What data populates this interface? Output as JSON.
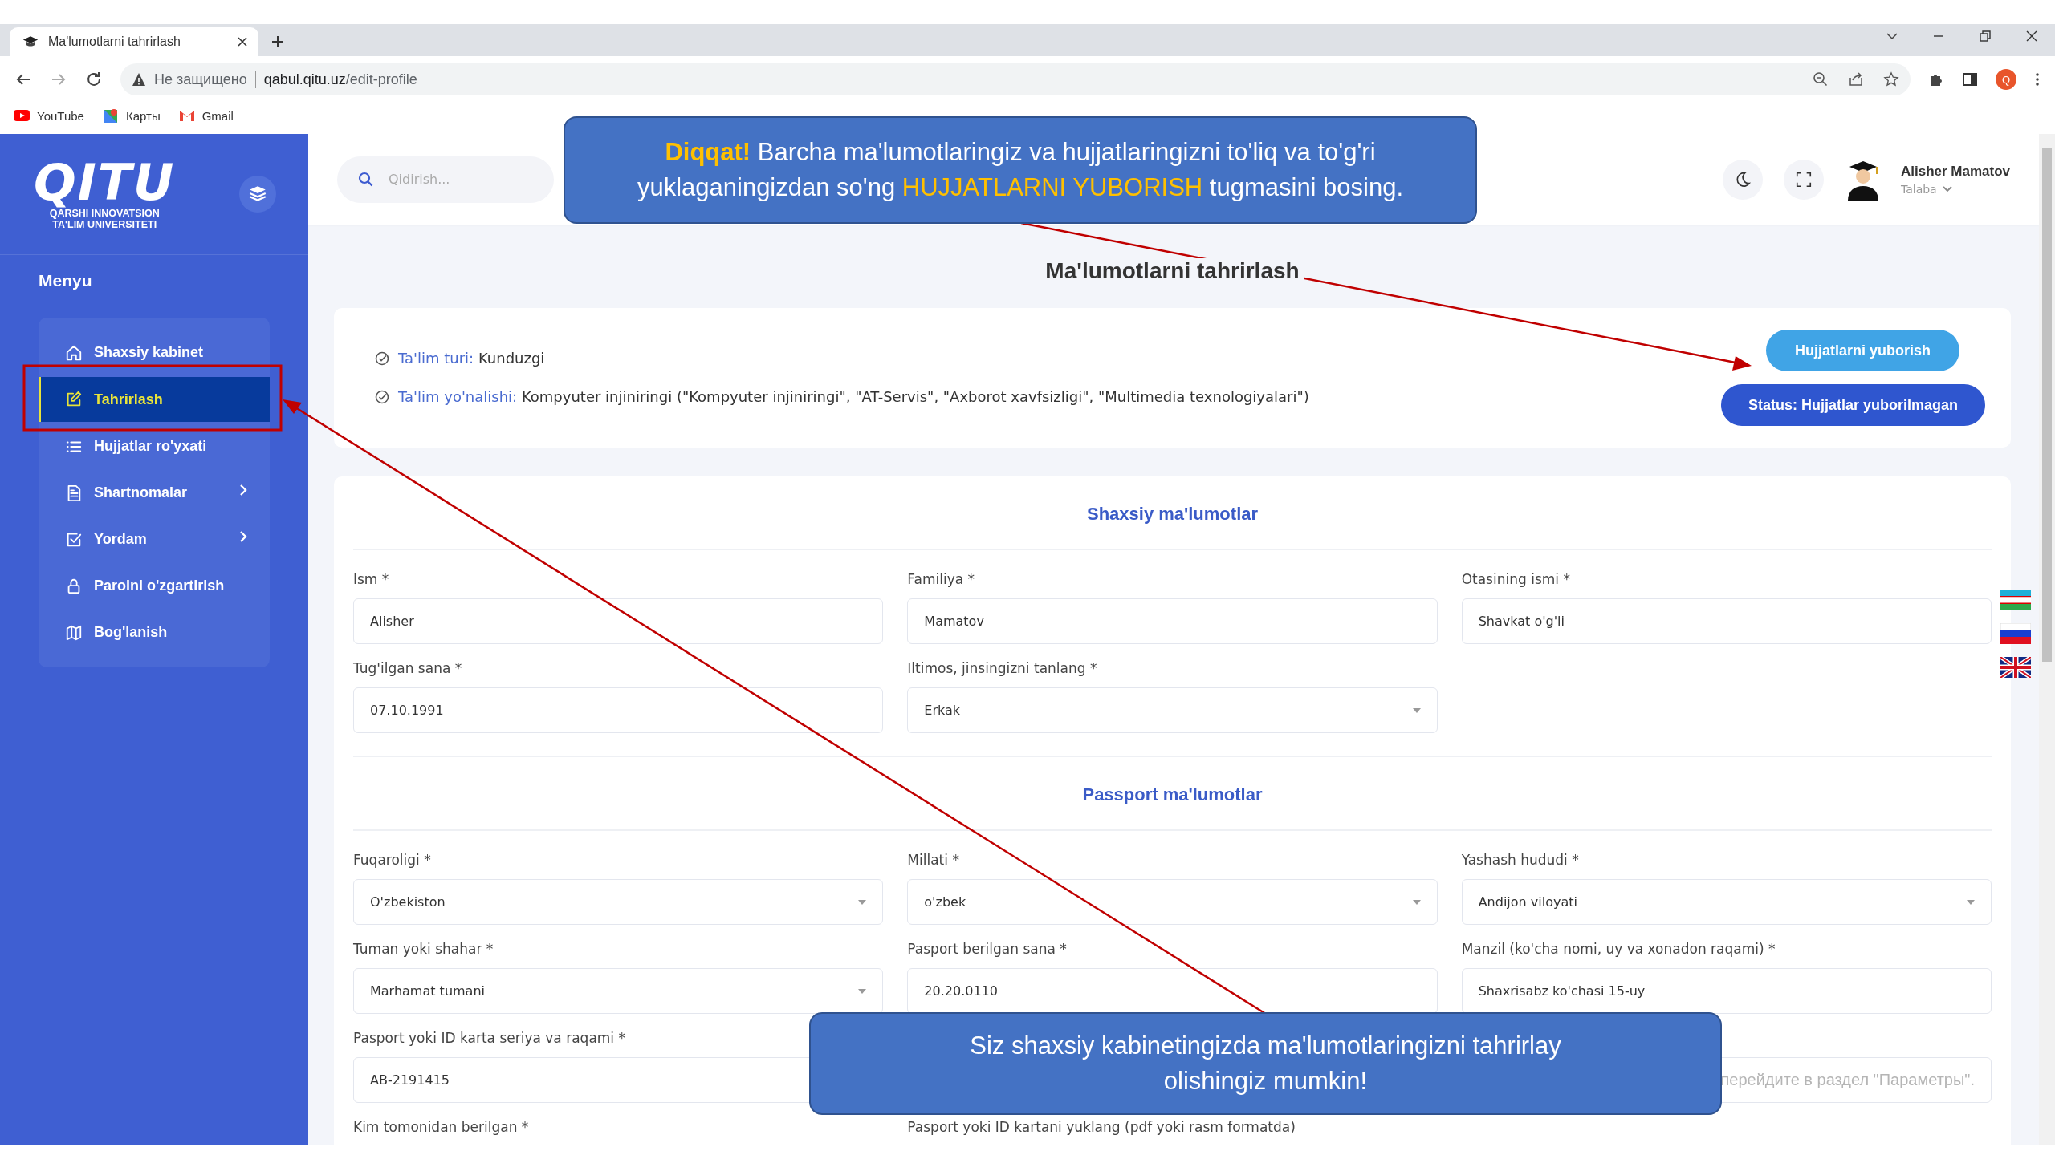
{
  "browser": {
    "tab_title": "Ma'lumotlarni tahrirlash",
    "security": "Не защищено",
    "url_host": "qabul.qitu.uz",
    "url_path": "/edit-profile",
    "profile_initial": "Q",
    "bookmarks": [
      {
        "label": "YouTube",
        "kind": "youtube"
      },
      {
        "label": "Карты",
        "kind": "maps"
      },
      {
        "label": "Gmail",
        "kind": "gmail"
      }
    ]
  },
  "sidebar": {
    "logo_word": "QITU",
    "logo_subtitle": [
      "QARSHI INNOVATSION",
      "TA'LIM UNIVERSITETI"
    ],
    "menu_title": "Menyu",
    "items": [
      {
        "label": "Shaxsiy kabinet",
        "kind": "link",
        "selected": false
      },
      {
        "label": "Tahrirlash",
        "kind": "link",
        "selected": true
      },
      {
        "label": "Hujjatlar ro'yxati",
        "kind": "link",
        "selected": false
      },
      {
        "label": "Shartnomalar",
        "kind": "submenu",
        "selected": false
      },
      {
        "label": "Yordam",
        "kind": "submenu",
        "selected": false
      },
      {
        "label": "Parolni o'zgartirish",
        "kind": "link",
        "selected": false
      },
      {
        "label": "Bog'lanish",
        "kind": "link",
        "selected": false
      }
    ]
  },
  "header": {
    "search_placeholder": "Qidirish...",
    "user_name": "Alisher Mamatov",
    "user_role": "Talaba"
  },
  "page_title": "Ma'lumotlarni tahrirlash",
  "info": [
    {
      "label": "Ta'lim turi:",
      "value": "Kunduzgi"
    },
    {
      "label": "Ta'lim yo'nalishi:",
      "value": "Kompyuter injiniringi (\"Kompyuter injiniringi\", \"AT-Servis\", \"Axborot xavfsizligi\", \"Multimedia texnologiyalari\")"
    }
  ],
  "submit_button": "Hujjatlarni yuborish",
  "status_button": "Status: Hujjatlar yuborilmagan",
  "sections": [
    {
      "title": "Shaxsiy ma'lumotlar",
      "rows": [
        [
          {
            "kind": "text",
            "label": "Ism *",
            "value": "Alisher"
          },
          {
            "kind": "text",
            "label": "Familiya *",
            "value": "Mamatov"
          },
          {
            "kind": "text",
            "label": "Otasining ismi *",
            "value": "Shavkat o'g'li"
          }
        ],
        [
          {
            "kind": "text",
            "label": "Tug'ilgan sana *",
            "value": "07.10.1991"
          },
          {
            "kind": "select",
            "label": "Iltimos, jinsingizni tanlang *",
            "value": "Erkak"
          },
          {
            "kind": "empty"
          }
        ]
      ]
    },
    {
      "title": "Passport ma'lumotlar",
      "rows": [
        [
          {
            "kind": "select",
            "label": "Fuqaroligi *",
            "value": "O'zbekiston"
          },
          {
            "kind": "select",
            "label": "Millati *",
            "value": "o'zbek"
          },
          {
            "kind": "select",
            "label": "Yashash hududi *",
            "value": "Andijon viloyati"
          }
        ],
        [
          {
            "kind": "select",
            "label": "Tuman yoki shahar *",
            "value": "Marhamat tumani"
          },
          {
            "kind": "text",
            "label": "Pasport berilgan sana *",
            "value": "20.20.0110"
          },
          {
            "kind": "text",
            "label": "Manzil (ko'cha nomi, uy va xonadon raqami) *",
            "value": "Shaxrisabz ko'chasi 15-uy"
          }
        ],
        [
          {
            "kind": "text",
            "label": "Pasport yoki ID karta seriya va raqami *",
            "value": "AB-2191415"
          },
          {
            "kind": "empty"
          },
          {
            "kind": "blank",
            "notice": "перейдите в раздел \"Параметры\"."
          }
        ],
        [
          {
            "kind": "label",
            "label": "Kim tomonidan berilgan *"
          },
          {
            "kind": "label",
            "label": "Pasport yoki ID kartani yuklang (pdf yoki rasm formatda)"
          },
          {
            "kind": "empty"
          }
        ]
      ]
    }
  ],
  "callouts": [
    {
      "segments": [
        {
          "text": "**Diqqat!**",
          "highlight": true
        },
        {
          "text": " Barcha ma'lumotlaringiz va hujjatlaringizni to'liq va to'g'ri yuklaganingizdan so'ng ",
          "highlight": false
        },
        {
          "text": "HUJJATLARNI YUBORISH",
          "highlight": true
        },
        {
          "text": " tugmasini bosing.",
          "highlight": false
        }
      ]
    },
    {
      "segments": [
        {
          "text": "Siz shaxsiy kabinetingizda ma'lumotlaringizni tahrirlay olishingiz mumkin!",
          "highlight": false
        }
      ]
    }
  ]
}
